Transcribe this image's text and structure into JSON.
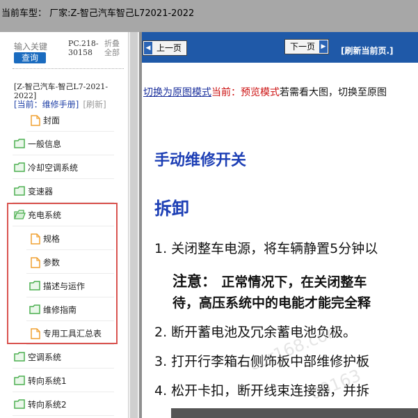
{
  "window": {
    "title": "当前车型：  厂家:Z-智己汽车智己L72021-2022"
  },
  "sidebar": {
    "keyword_label": "输入关键",
    "query_button": "查询",
    "pc_code": "PC.218-30158",
    "collapse_all": "折叠全部",
    "tree_header": "[Z-智己汽车-智己L7-2021-2022]",
    "current_mode": "[当前：维修手册]",
    "refresh": "[刷新]",
    "items": [
      {
        "label": "封面",
        "type": "doc"
      },
      {
        "label": "一般信息",
        "type": "folder"
      },
      {
        "label": "冷却空调系统",
        "type": "folder"
      },
      {
        "label": "变速器",
        "type": "folder"
      },
      {
        "label": "充电系统",
        "type": "folder-open"
      },
      {
        "label": "规格",
        "type": "doc"
      },
      {
        "label": "参数",
        "type": "doc"
      },
      {
        "label": "描述与运作",
        "type": "folder"
      },
      {
        "label": "维修指南",
        "type": "folder"
      },
      {
        "label": "专用工具汇总表",
        "type": "doc"
      },
      {
        "label": "空调系统",
        "type": "folder"
      },
      {
        "label": "转向系统1",
        "type": "folder"
      },
      {
        "label": "转向系统2",
        "type": "folder"
      }
    ]
  },
  "toolbar": {
    "prev_page": "上一页",
    "next_page": "下一页",
    "refresh_page": "[刷新当前页.]"
  },
  "mode_line": {
    "link": "切换为原图模式",
    "current": "当前：预览模式",
    "rest": "若需看大图，切换至原图"
  },
  "document": {
    "title": "手动维修开关",
    "section": "拆卸",
    "step1": "1. 关闭整车电源，将车辆静置5分钟以",
    "note_label": "注意：",
    "note_line1": "正常情况下，在关闭整车",
    "note_line2": "待，高压系统中的电能才能完全释",
    "step2": "2. 断开蓄电池及冗余蓄电池负极。",
    "step3": "3. 打开行李箱右侧饰板中部维修护板",
    "step4": "4. 松开卡扣，断开线束连接器，并拆"
  },
  "watermark": {
    "line1": "car168.com",
    "line2": "00163"
  },
  "colors": {
    "accent_blue": "#1d3fb5",
    "nav_blue": "#1f59a8",
    "current_red": "#cc1111",
    "highlight_red": "#d9534f",
    "folder_green": "#4caf50",
    "doc_orange": "#f0a030"
  }
}
